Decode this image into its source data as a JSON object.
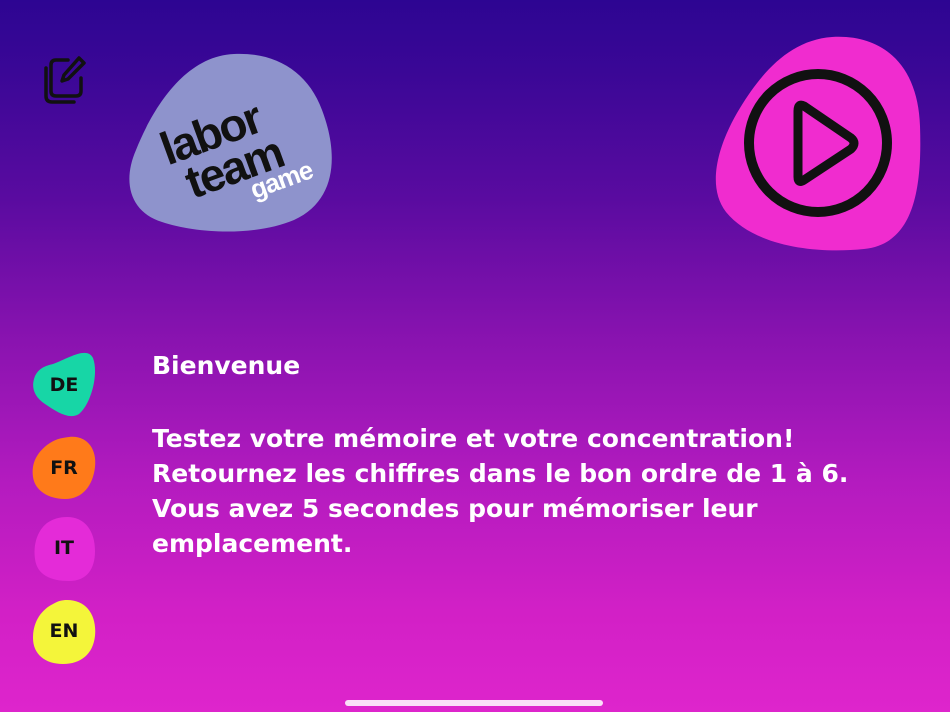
{
  "logo": {
    "line1": "labor",
    "line2": "team",
    "line3": "game",
    "shape_color": "#8e93cc"
  },
  "icons": {
    "edit": "edit-copy-icon",
    "play": "play-circle-icon"
  },
  "languages": [
    {
      "code": "DE",
      "color": "#17d6a6"
    },
    {
      "code": "FR",
      "color": "#ff7a1a"
    },
    {
      "code": "IT",
      "color": "#e42bd8"
    },
    {
      "code": "EN",
      "color": "#f4f53a"
    }
  ],
  "content": {
    "title": "Bienvenue",
    "lines": [
      "Testez votre mémoire et votre concentration!",
      "Retournez les chiffres dans le bon ordre de 1 à 6.",
      "Vous avez 5 secondes pour mémoriser leur",
      "emplacement."
    ]
  },
  "colors": {
    "play_bg": "#f02ccf",
    "background_top": "#2d0592",
    "background_bottom": "#de25cc"
  }
}
